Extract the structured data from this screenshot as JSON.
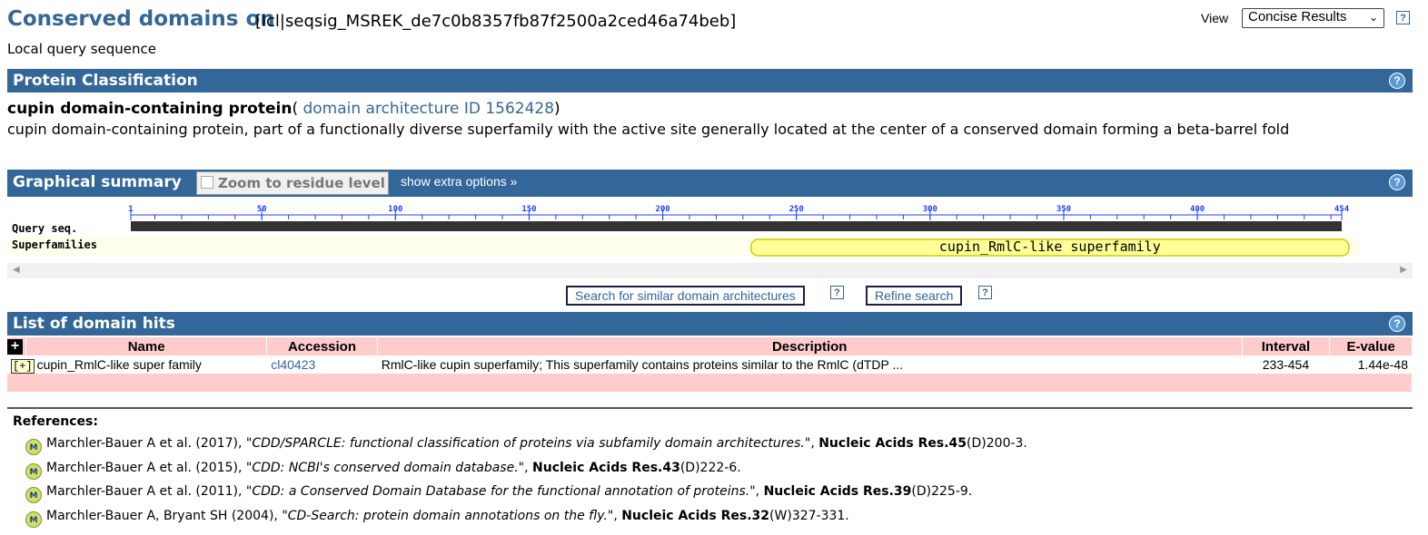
{
  "header": {
    "title": "Conserved domains on",
    "query_id": "[lcl|seqsig_MSREK_de7c0b8357fb87f2500a2ced46a74beb]",
    "subtitle": "Local query sequence",
    "view_label": "View",
    "view_selected": "Concise Results",
    "help_glyph": "?"
  },
  "classification": {
    "bar_title": "Protein Classification",
    "protein_name": "cupin domain-containing protein",
    "paren_open": "(",
    "arch_link": " domain architecture ID 1562428",
    "paren_close": ")",
    "description": "cupin domain-containing protein, part of a functionally diverse superfamily with the active site generally located at the center of a conserved domain forming a beta-barrel fold"
  },
  "graphical": {
    "bar_title": "Graphical summary",
    "zoom_label": "Zoom to residue level",
    "extra_options": "show extra options »",
    "row_query": "Query seq.",
    "row_superfamilies": "Superfamilies",
    "ticks": [
      "1",
      "50",
      "100",
      "150",
      "200",
      "250",
      "300",
      "350",
      "400",
      "454"
    ],
    "seq_length": 454,
    "domain": {
      "label": "cupin_RmlC-like superfamily",
      "start": 233,
      "end": 454,
      "fill": "#ffff99",
      "stroke": "#cccc00"
    }
  },
  "buttons": {
    "similar": "Search for similar domain architectures",
    "refine": "Refine search"
  },
  "hits": {
    "bar_title": "List of domain hits",
    "expand_glyph": "+",
    "columns": [
      "Name",
      "Accession",
      "Description",
      "Interval",
      "E-value"
    ],
    "rows": [
      {
        "toggle": "[+]",
        "name": "cupin_RmlC-like super family",
        "accession": "cl40423",
        "description": "RmlC-like cupin superfamily; This superfamily contains proteins similar to the RmlC (dTDP ...",
        "interval": "233-454",
        "evalue": "1.44e-48"
      }
    ]
  },
  "references": {
    "title": "References:",
    "icon_text": "M",
    "items": [
      {
        "authors": "Marchler-Bauer A et al. (2017), ",
        "title": "\"CDD/SPARCLE: functional classification of proteins via subfamily domain architectures.\"",
        "journal": "Nucleic Acids Res.45",
        "pages": "(D)200-3."
      },
      {
        "authors": "Marchler-Bauer A et al. (2015), ",
        "title": "\"CDD: NCBI's conserved domain database.\"",
        "journal": "Nucleic Acids Res.43",
        "pages": "(D)222-6."
      },
      {
        "authors": "Marchler-Bauer A et al. (2011), ",
        "title": "\"CDD: a Conserved Domain Database for the functional annotation of proteins.\"",
        "journal": "Nucleic Acids Res.39",
        "pages": "(D)225-9."
      },
      {
        "authors": "Marchler-Bauer A, Bryant SH (2004), ",
        "title": "\"CD-Search: protein domain annotations on the fly.\"",
        "journal": "Nucleic Acids Res.32",
        "pages": "(W)327-331."
      }
    ]
  },
  "colors": {
    "bar_blue": "#336699",
    "table_pink": "#ffcccc",
    "domain_yellow": "#ffff99"
  }
}
